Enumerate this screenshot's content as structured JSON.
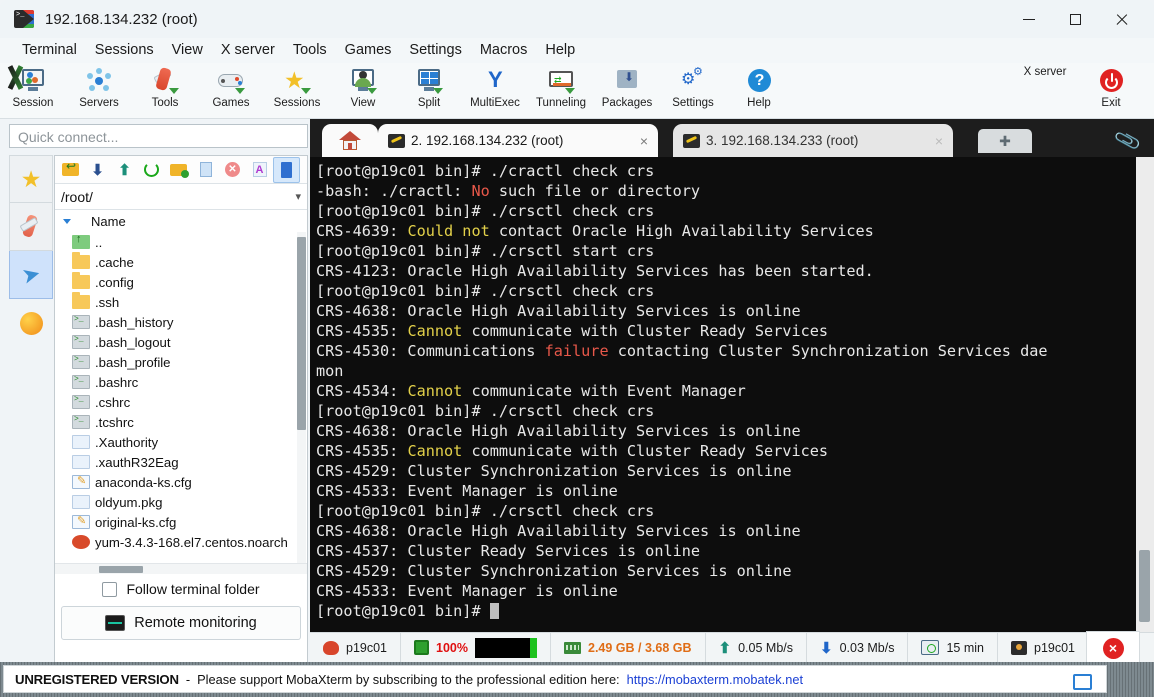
{
  "window": {
    "title": "192.168.134.232 (root)",
    "icon": "mobaxterm-logo-icon",
    "controls": {
      "minimize": "—",
      "maximize": "□",
      "close": "×"
    }
  },
  "menubar": {
    "items": [
      {
        "label": "Terminal"
      },
      {
        "label": "Sessions"
      },
      {
        "label": "View"
      },
      {
        "label": "X server"
      },
      {
        "label": "Tools"
      },
      {
        "label": "Games"
      },
      {
        "label": "Settings"
      },
      {
        "label": "Macros"
      },
      {
        "label": "Help"
      }
    ]
  },
  "toolbar": {
    "left_items": [
      {
        "label": "Session",
        "icon": "session-monitor-icon"
      },
      {
        "label": "Servers",
        "icon": "servers-network-icon"
      },
      {
        "label": "Tools",
        "icon": "tools-knife-icon"
      },
      {
        "label": "Games",
        "icon": "games-gamepad-icon"
      },
      {
        "label": "Sessions",
        "icon": "sessions-star-icon"
      },
      {
        "label": "View",
        "icon": "view-monitor-icon"
      },
      {
        "label": "Split",
        "icon": "split-panes-icon"
      },
      {
        "label": "MultiExec",
        "icon": "multiexec-fork-icon"
      },
      {
        "label": "Tunneling",
        "icon": "tunneling-icon"
      },
      {
        "label": "Packages",
        "icon": "packages-download-icon"
      },
      {
        "label": "Settings",
        "icon": "settings-gear-icon"
      },
      {
        "label": "Help",
        "icon": "help-question-icon"
      }
    ],
    "right_items": [
      {
        "label": "X server",
        "icon": "x-server-icon"
      },
      {
        "label": "Exit",
        "icon": "exit-power-icon"
      }
    ]
  },
  "sidebar": {
    "quick_connect_placeholder": "Quick connect...",
    "vertical_tabs": [
      {
        "name": "sessions",
        "icon": "star-icon",
        "active": false
      },
      {
        "name": "tools",
        "icon": "swiss-knife-icon",
        "active": false
      },
      {
        "name": "sftp",
        "icon": "paper-plane-icon",
        "active": true
      },
      {
        "name": "macros",
        "icon": "globe-icon",
        "active": false
      }
    ],
    "file_browser": {
      "toolbar_icons": [
        {
          "name": "parent-folder-icon",
          "selected": false
        },
        {
          "name": "download-icon",
          "selected": false
        },
        {
          "name": "upload-icon",
          "selected": false
        },
        {
          "name": "refresh-icon",
          "selected": false
        },
        {
          "name": "new-folder-icon",
          "selected": false
        },
        {
          "name": "new-file-icon",
          "selected": false
        },
        {
          "name": "delete-icon",
          "selected": false
        },
        {
          "name": "text-mode-icon",
          "selected": false
        },
        {
          "name": "binary-mode-icon",
          "selected": true
        }
      ],
      "path": "/root/",
      "column_header": "Name",
      "rows": [
        {
          "name": "..",
          "type": "parent"
        },
        {
          "name": ".cache",
          "type": "folder"
        },
        {
          "name": ".config",
          "type": "folder"
        },
        {
          "name": ".ssh",
          "type": "folder"
        },
        {
          "name": ".bash_history",
          "type": "shell"
        },
        {
          "name": ".bash_logout",
          "type": "shell"
        },
        {
          "name": ".bash_profile",
          "type": "shell"
        },
        {
          "name": ".bashrc",
          "type": "shell"
        },
        {
          "name": ".cshrc",
          "type": "shell"
        },
        {
          "name": ".tcshrc",
          "type": "shell"
        },
        {
          "name": ".Xauthority",
          "type": "doc"
        },
        {
          "name": ".xauthR32Eag",
          "type": "doc"
        },
        {
          "name": "anaconda-ks.cfg",
          "type": "cfg"
        },
        {
          "name": "oldyum.pkg",
          "type": "doc"
        },
        {
          "name": "original-ks.cfg",
          "type": "cfg"
        },
        {
          "name": "yum-3.4.3-168.el7.centos.noarch",
          "type": "rpm"
        }
      ],
      "follow_terminal_folder_label": "Follow terminal folder",
      "follow_terminal_folder_checked": false,
      "remote_monitoring_label": "Remote monitoring"
    }
  },
  "tabs": {
    "home": {
      "icon": "home-icon"
    },
    "items": [
      {
        "label": "2. 192.168.134.232 (root)",
        "icon": "key-icon",
        "active": true,
        "close": "×"
      },
      {
        "label": "3. 192.168.134.233 (root)",
        "icon": "key-icon",
        "active": false,
        "close": "×"
      }
    ],
    "new_tab_label": "✚",
    "attach_icon": "paperclip-icon"
  },
  "terminal": {
    "prompt": "[root@p19c01 bin]# ",
    "lines": [
      {
        "segments": [
          {
            "t": "[root@p19c01 bin]# ./cractl check crs",
            "c": "w"
          }
        ]
      },
      {
        "segments": [
          {
            "t": "-bash: ./cractl: ",
            "c": "w"
          },
          {
            "t": "No",
            "c": "r"
          },
          {
            "t": " such file or directory",
            "c": "w"
          }
        ]
      },
      {
        "segments": [
          {
            "t": "[root@p19c01 bin]# ./crsctl check crs",
            "c": "w"
          }
        ]
      },
      {
        "segments": [
          {
            "t": "CRS-4639: ",
            "c": "w"
          },
          {
            "t": "Could not",
            "c": "y"
          },
          {
            "t": " contact Oracle High Availability Services",
            "c": "w"
          }
        ]
      },
      {
        "segments": [
          {
            "t": "[root@p19c01 bin]# ./crsctl start crs",
            "c": "w"
          }
        ]
      },
      {
        "segments": [
          {
            "t": "CRS-4123: Oracle High Availability Services has been started.",
            "c": "w"
          }
        ]
      },
      {
        "segments": [
          {
            "t": "[root@p19c01 bin]# ./crsctl check crs",
            "c": "w"
          }
        ]
      },
      {
        "segments": [
          {
            "t": "CRS-4638: Oracle High Availability Services is online",
            "c": "w"
          }
        ]
      },
      {
        "segments": [
          {
            "t": "CRS-4535: ",
            "c": "w"
          },
          {
            "t": "Cannot",
            "c": "y"
          },
          {
            "t": " communicate with Cluster Ready Services",
            "c": "w"
          }
        ]
      },
      {
        "segments": [
          {
            "t": "CRS-4530: Communications ",
            "c": "w"
          },
          {
            "t": "failure",
            "c": "r"
          },
          {
            "t": " contacting Cluster Synchronization Services dae",
            "c": "w"
          }
        ]
      },
      {
        "segments": [
          {
            "t": "mon",
            "c": "w"
          }
        ]
      },
      {
        "segments": [
          {
            "t": "CRS-4534: ",
            "c": "w"
          },
          {
            "t": "Cannot",
            "c": "y"
          },
          {
            "t": " communicate with Event Manager",
            "c": "w"
          }
        ]
      },
      {
        "segments": [
          {
            "t": "[root@p19c01 bin]# ./crsctl check crs",
            "c": "w"
          }
        ]
      },
      {
        "segments": [
          {
            "t": "CRS-4638: Oracle High Availability Services is online",
            "c": "w"
          }
        ]
      },
      {
        "segments": [
          {
            "t": "CRS-4535: ",
            "c": "w"
          },
          {
            "t": "Cannot",
            "c": "y"
          },
          {
            "t": " communicate with Cluster Ready Services",
            "c": "w"
          }
        ]
      },
      {
        "segments": [
          {
            "t": "CRS-4529: Cluster Synchronization Services is online",
            "c": "w"
          }
        ]
      },
      {
        "segments": [
          {
            "t": "CRS-4533: Event Manager is online",
            "c": "w"
          }
        ]
      },
      {
        "segments": [
          {
            "t": "[root@p19c01 bin]# ./crsctl check crs",
            "c": "w"
          }
        ]
      },
      {
        "segments": [
          {
            "t": "CRS-4638: Oracle High Availability Services is online",
            "c": "w"
          }
        ]
      },
      {
        "segments": [
          {
            "t": "CRS-4537: Cluster Ready Services is online",
            "c": "w"
          }
        ]
      },
      {
        "segments": [
          {
            "t": "CRS-4529: Cluster Synchronization Services is online",
            "c": "w"
          }
        ]
      },
      {
        "segments": [
          {
            "t": "CRS-4533: Event Manager is online",
            "c": "w"
          }
        ]
      },
      {
        "segments": [
          {
            "t": "[root@p19c01 bin]# ",
            "c": "w"
          },
          {
            "t": "",
            "c": "cursor"
          }
        ]
      }
    ],
    "colors": {
      "background": "#0d0d0d",
      "foreground": "#e8e8e8",
      "red": "#e8584a",
      "yellow": "#e3d14a"
    }
  },
  "statusbar": {
    "host": "p19c01",
    "cpu_label": "100%",
    "memory": "2.49 GB / 3.68 GB",
    "upload": "0.05 Mb/s",
    "download": "0.03 Mb/s",
    "uptime": "15 min",
    "user": "p19c01",
    "close_label": "×",
    "colors": {
      "cpu": "#e01010",
      "memory": "#e06d16"
    }
  },
  "footer": {
    "badge": "UNREGISTERED VERSION",
    "separator": "-",
    "message": "Please support MobaXterm by subscribing to the professional edition here:",
    "link": "https://mobaxterm.mobatek.net",
    "monitor_icon": "display-icon"
  }
}
